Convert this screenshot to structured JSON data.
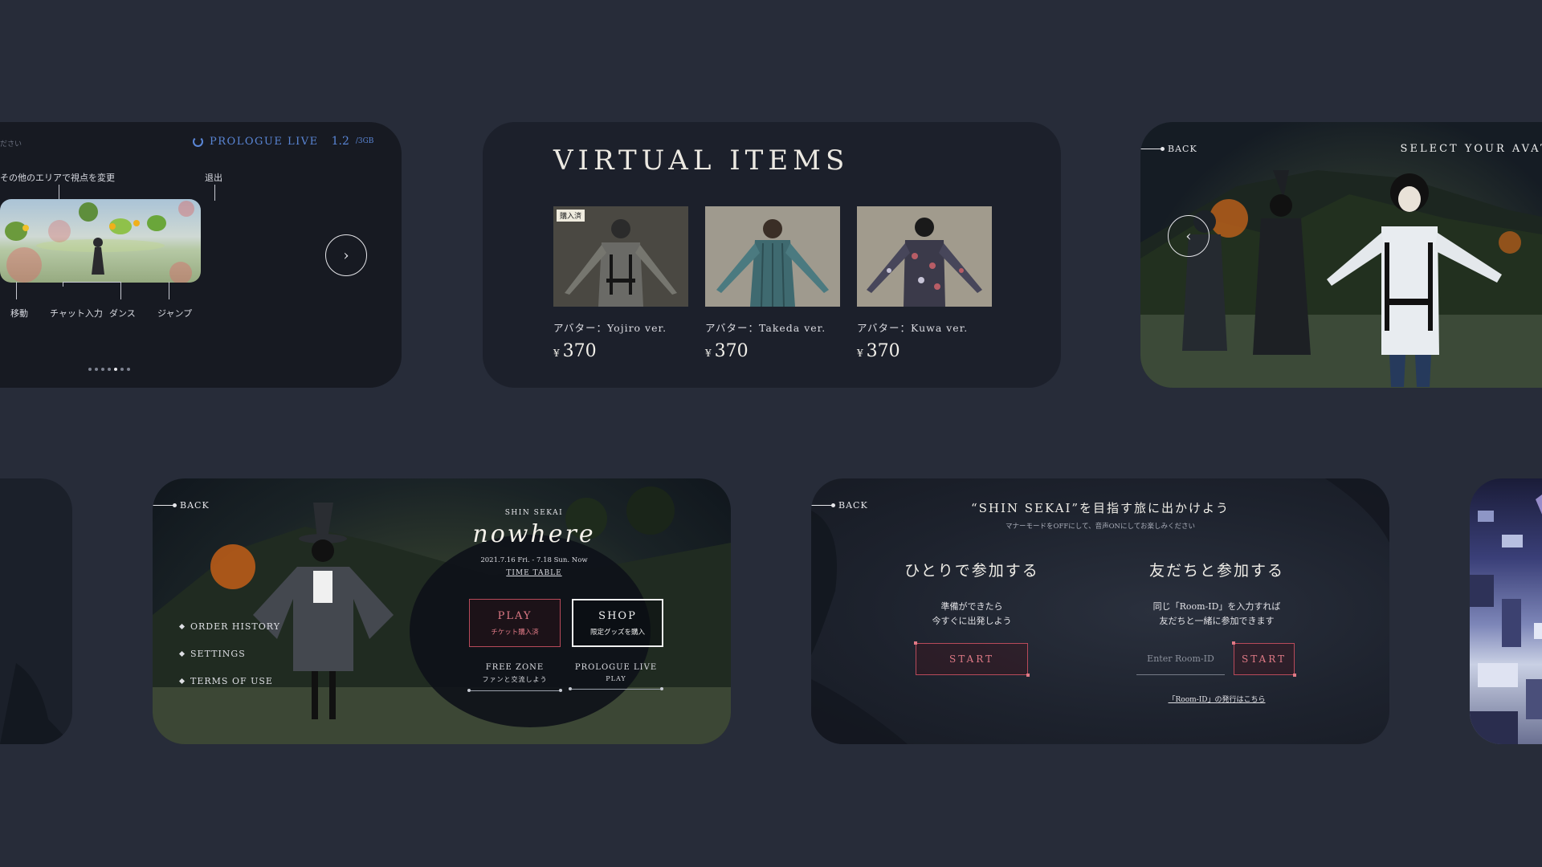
{
  "tutorial": {
    "hint_fragment": "ださい",
    "live_label": "PROLOGUE LIVE",
    "size_value": "1.2",
    "size_unit": "/3GB",
    "labels": {
      "view_change": "その他のエリアで視点を変更",
      "exit": "退出",
      "move": "移動",
      "chat": "チャット入力",
      "dance": "ダンス",
      "jump": "ジャンプ"
    },
    "pager_total": 7,
    "pager_active": 5,
    "next_icon": "chevron-right-icon"
  },
  "items": {
    "title": "VIRTUAL ITEMS",
    "purchased_badge": "購入済",
    "currency": "¥",
    "list": [
      {
        "name": "アバター：Yojiro ver.",
        "price": "370"
      },
      {
        "name": "アバター：Takeda ver.",
        "price": "370"
      },
      {
        "name": "アバター：Kuwa ver.",
        "price": "370"
      }
    ]
  },
  "avatar": {
    "back_label": "BACK",
    "title": "SELECT YOUR AVATAR",
    "prev_icon": "chevron-left-icon"
  },
  "main": {
    "back_label": "BACK",
    "brand_small": "SHIN SEKAI",
    "logo": "nowhere",
    "dates": "2021.7.16 Fri. - 7.18 Sun.  Now",
    "timetable": "TIME TABLE",
    "play": {
      "label": "PLAY",
      "sub": "チケット購入済"
    },
    "shop": {
      "label": "SHOP",
      "sub": "限定グッズを購入"
    },
    "free_zone": {
      "label": "FREE ZONE",
      "sub": "ファンと交流しよう"
    },
    "prologue": {
      "label": "PROLOGUE LIVE",
      "sub": "PLAY"
    },
    "menu": [
      "ORDER HISTORY",
      "SETTINGS",
      "TERMS OF USE"
    ]
  },
  "join": {
    "back_label": "BACK",
    "title": "“SHIN SEKAI”を目指す旅に出かけよう",
    "subtitle": "マナーモードをOFFにして、音声ONにしてお楽しみください",
    "solo": {
      "title": "ひとりで参加する",
      "text": "準備ができたら\n今すぐに出発しよう",
      "button": "START"
    },
    "friends": {
      "title": "友だちと参加する",
      "text": "同じ「Room-ID」を入力すれば\n友だちと一緒に参加できます",
      "button": "START",
      "placeholder": "Enter Room-ID"
    },
    "room_link": "「Room-ID」の発行はこちら"
  },
  "colors": {
    "background": "#272c39",
    "card": "#1a1e28",
    "accent_red": "#b84a5a",
    "accent_blue": "#5a86d6"
  }
}
